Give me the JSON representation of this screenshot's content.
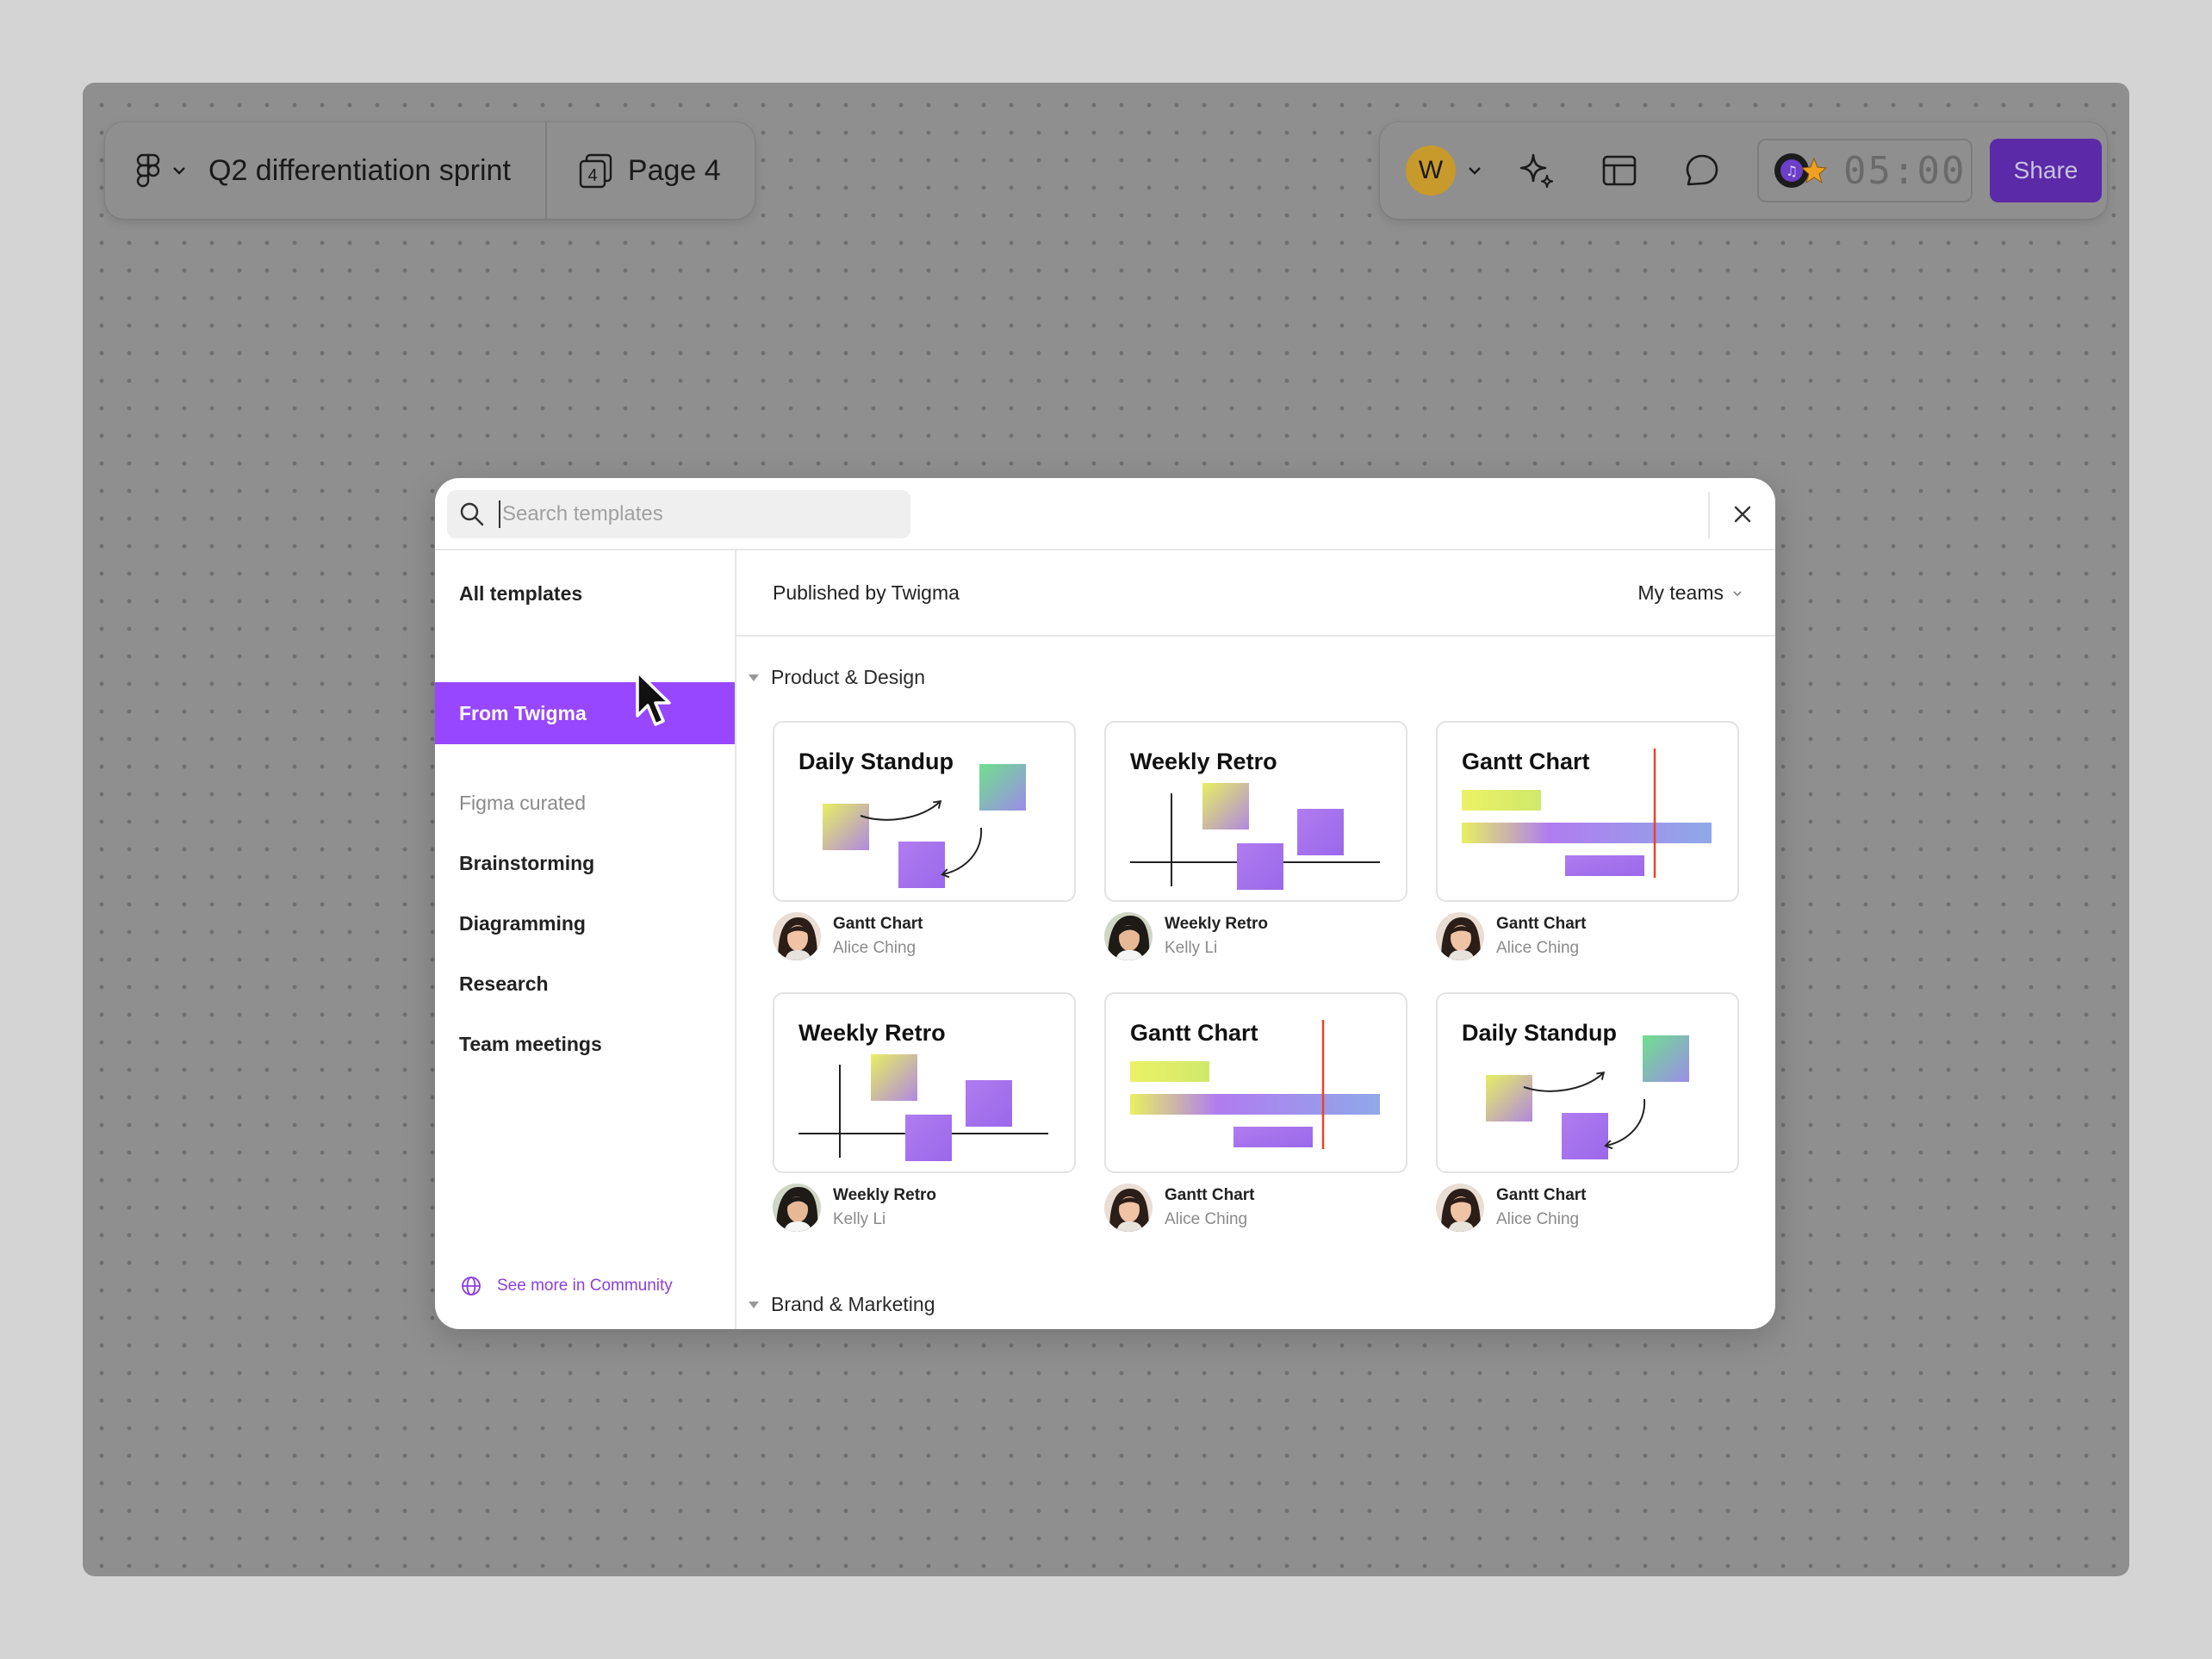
{
  "toolbar": {
    "file_title": "Q2 differentiation sprint",
    "page_number": "4",
    "page_label": "Page 4",
    "avatar_initial": "W",
    "timer": "05:00",
    "share_label": "Share"
  },
  "modal": {
    "search_placeholder": "Search templates",
    "sidebar": {
      "all_templates": "All templates",
      "from_twigma": "From Twigma",
      "curated_heading": "Figma curated",
      "categories": [
        "Brainstorming",
        "Diagramming",
        "Research",
        "Team meetings"
      ],
      "community_link": "See more in Community"
    },
    "header": {
      "published": "Published by Twigma",
      "teams": "My teams"
    },
    "sections": [
      "Product & Design",
      "Brand & Marketing"
    ],
    "cards": [
      {
        "title": "Daily Standup",
        "name": "Gantt Chart",
        "author": "Alice Ching"
      },
      {
        "title": "Weekly Retro",
        "name": "Weekly Retro",
        "author": "Kelly Li"
      },
      {
        "title": "Gantt Chart",
        "name": "Gantt Chart",
        "author": "Alice Ching"
      },
      {
        "title": "Weekly Retro",
        "name": "Weekly Retro",
        "author": "Kelly Li"
      },
      {
        "title": "Gantt Chart",
        "name": "Gantt Chart",
        "author": "Alice Ching"
      },
      {
        "title": "Daily Standup",
        "name": "Gantt Chart",
        "author": "Alice Ching"
      }
    ]
  },
  "colors": {
    "accent": "#9747ff",
    "share": "#5a2aa8",
    "marker_red": "#e8442a"
  }
}
